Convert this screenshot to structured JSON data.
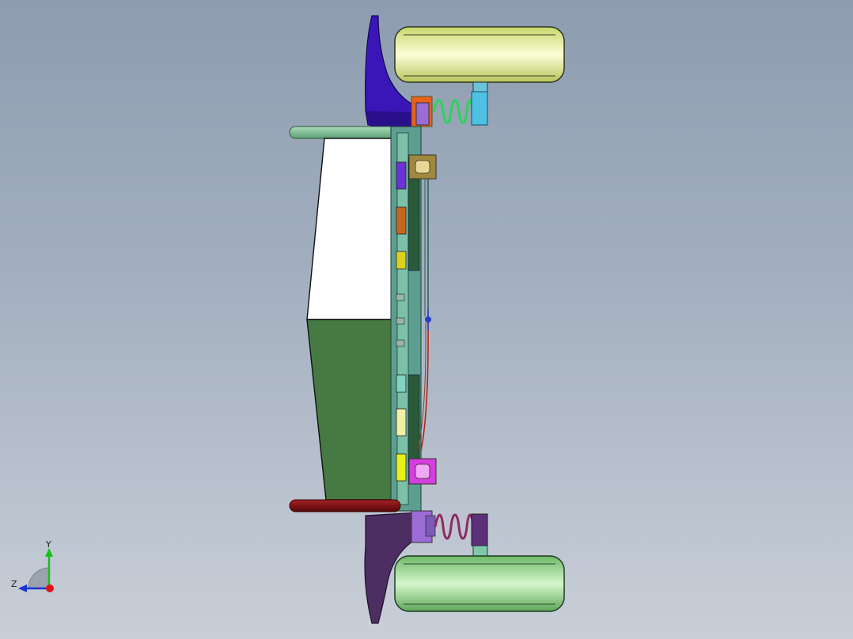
{
  "viewport": {
    "background_top": "#8d9cb0",
    "background_bottom": "#c9cfd8"
  },
  "triad": {
    "y_label": "Y",
    "z_label": "Z",
    "colors": {
      "y": "#18c01e",
      "z": "#1a35d6",
      "x": "#e01515"
    }
  },
  "model": {
    "parts": [
      "upper-wheel",
      "lower-wheel",
      "upper-fender",
      "lower-fender",
      "upper-spring",
      "lower-spring",
      "upper-bumper-bar",
      "lower-bumper-bar",
      "battery-box",
      "chassis-rail",
      "upper-bracket",
      "lower-bracket",
      "steering-link",
      "component-blocks"
    ],
    "colors": {
      "upper_wheel": "#dde98a",
      "lower_wheel": "#9ed88e",
      "upper_fender": "#3a16b8",
      "lower_fender": "#4d2e63",
      "upper_spring": "#2bd458",
      "lower_spring": "#8e2a62",
      "upper_bar": "#88c7a0",
      "lower_bar": "#7a0f12",
      "box_white": "#ffffff",
      "box_green": "#467a42",
      "rail": "#5c9f90",
      "upper_bracket": "#a08840",
      "lower_bracket": "#d53ee0",
      "link_red": "#b5261a",
      "link_blue": "#2a3fc4"
    }
  }
}
